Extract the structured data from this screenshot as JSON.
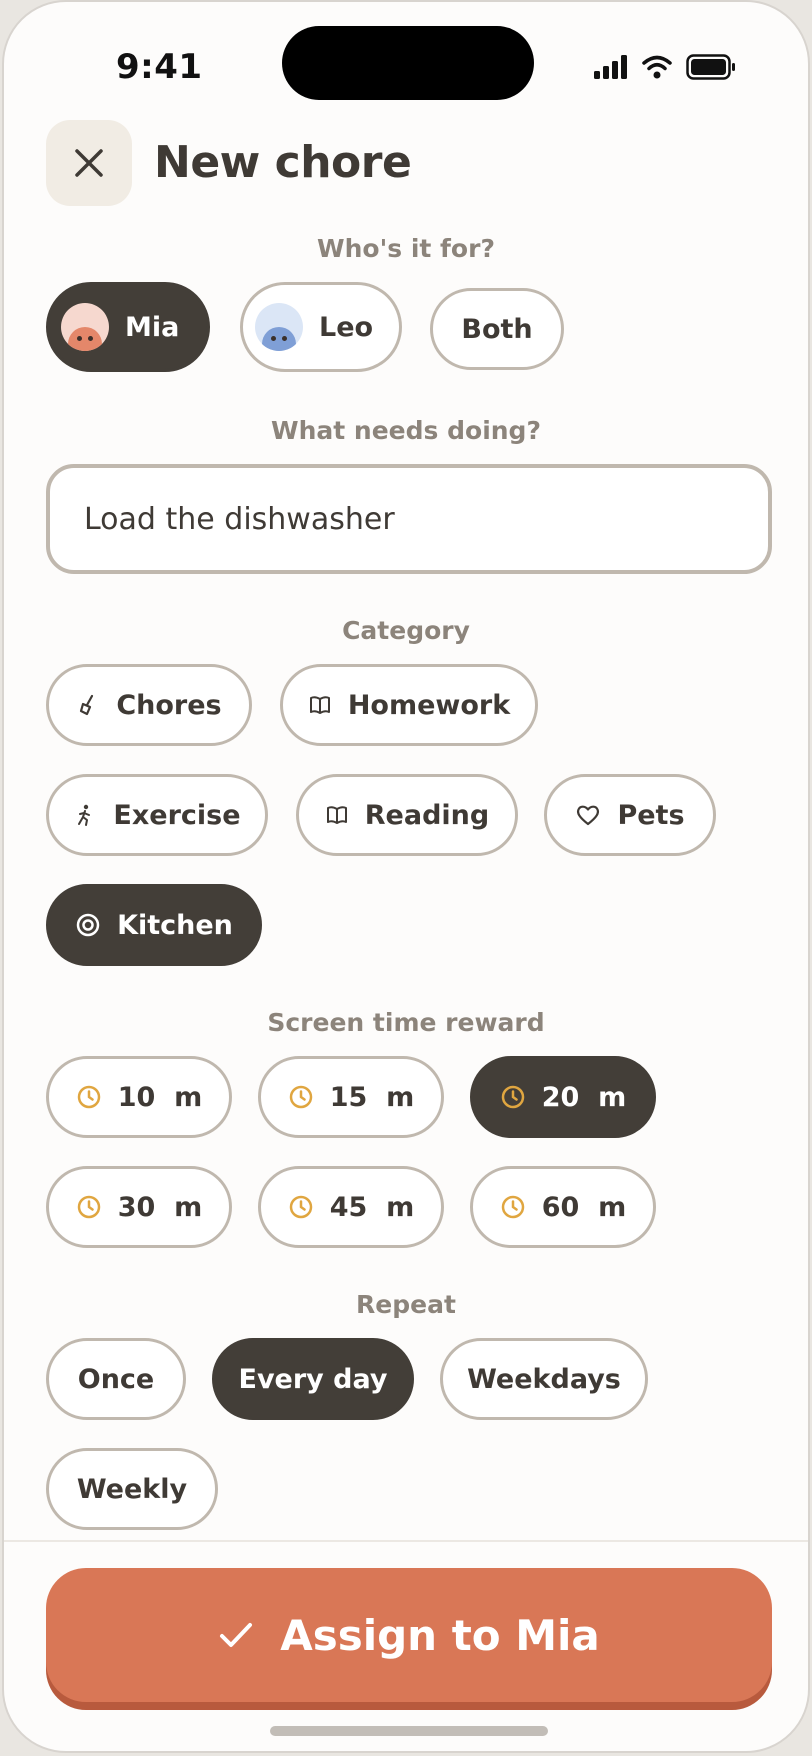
{
  "status_bar": {
    "time": "9:41"
  },
  "header": {
    "title": "New chore"
  },
  "who": {
    "label": "Who's it for?",
    "options": [
      {
        "label": "Mia",
        "selected": true
      },
      {
        "label": "Leo",
        "selected": false
      },
      {
        "label": "Both",
        "selected": false
      }
    ]
  },
  "task": {
    "label": "What needs doing?",
    "value": "Load the dishwasher"
  },
  "category": {
    "label": "Category",
    "options": [
      {
        "label": "Chores",
        "icon": "broom-icon",
        "selected": false
      },
      {
        "label": "Homework",
        "icon": "book-icon",
        "selected": false
      },
      {
        "label": "Exercise",
        "icon": "running-person-icon",
        "selected": false
      },
      {
        "label": "Reading",
        "icon": "book-icon",
        "selected": false
      },
      {
        "label": "Pets",
        "icon": "heart-icon",
        "selected": false
      },
      {
        "label": "Kitchen",
        "icon": "target-icon",
        "selected": true
      }
    ]
  },
  "reward": {
    "label": "Screen time reward",
    "options": [
      {
        "label": "10  m",
        "selected": false
      },
      {
        "label": "15  m",
        "selected": false
      },
      {
        "label": "20  m",
        "selected": true
      },
      {
        "label": "30  m",
        "selected": false
      },
      {
        "label": "45  m",
        "selected": false
      },
      {
        "label": "60  m",
        "selected": false
      }
    ]
  },
  "repeat": {
    "label": "Repeat",
    "options": [
      {
        "label": "Once",
        "selected": false
      },
      {
        "label": "Every day",
        "selected": true
      },
      {
        "label": "Weekdays",
        "selected": false
      },
      {
        "label": "Weekly",
        "selected": false
      }
    ]
  },
  "submit": {
    "label": "Assign to Mia"
  },
  "colors": {
    "accent": "#d97756",
    "selected_pill": "#433e38",
    "pill_border": "#c0b8ae",
    "clock_icon": "#e0a640",
    "background": "#fdfcfb"
  }
}
